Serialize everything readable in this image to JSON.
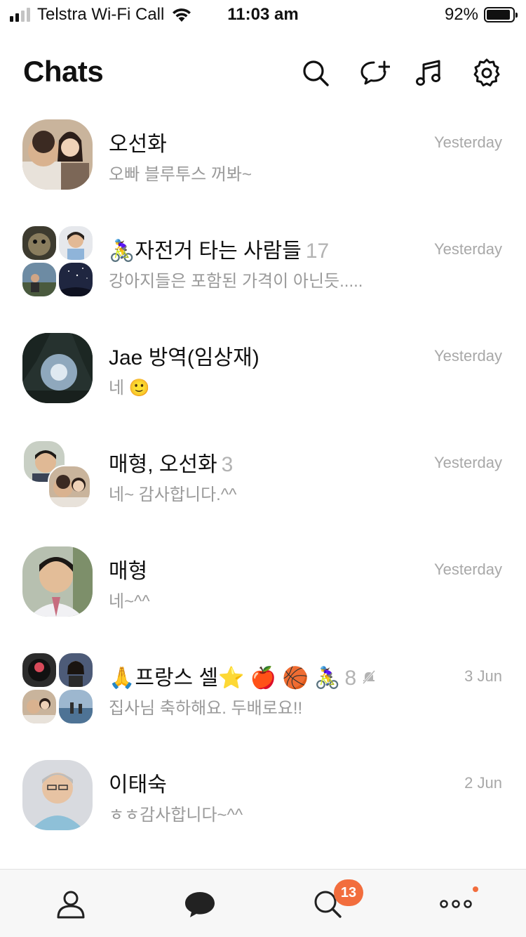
{
  "status_bar": {
    "carrier": "Telstra Wi-Fi Call",
    "time": "11:03 am",
    "battery": "92%",
    "battery_level": 0.92
  },
  "header": {
    "title": "Chats",
    "icons": [
      "search-icon",
      "new-chat-icon",
      "music-icon",
      "settings-icon"
    ]
  },
  "chats": [
    {
      "name": "오선화",
      "count": "",
      "preview": "오빠 블루투스 꺼봐~",
      "time": "Yesterday"
    },
    {
      "name": "🚴‍♀️자전거 타는 사람들",
      "count": "17",
      "preview": "강아지들은 포함된 가격이 아닌듯.....",
      "time": "Yesterday"
    },
    {
      "name": "Jae 방역(임상재)",
      "count": "",
      "preview": "네 🙂",
      "time": "Yesterday"
    },
    {
      "name": "매형, 오선화",
      "count": "3",
      "preview": "네~ 감사합니다.^^",
      "time": "Yesterday"
    },
    {
      "name": "매형",
      "count": "",
      "preview": "네~^^",
      "time": "Yesterday"
    },
    {
      "name": "🙏프랑스 셀⭐️ 🍎 🏀 🚴‍♀️",
      "count": "8",
      "preview": "집사님 축하해요. 두배로요!!",
      "time": "3 Jun",
      "muted": true
    },
    {
      "name": "이태숙",
      "count": "",
      "preview": "ㅎㅎ감사합니다~^^",
      "time": "2 Jun"
    }
  ],
  "tab_bar": {
    "tabs": [
      "friends-tab",
      "chats-tab",
      "view-tab",
      "more-tab"
    ],
    "view_badge": "13",
    "accent": "#f26d3d"
  }
}
